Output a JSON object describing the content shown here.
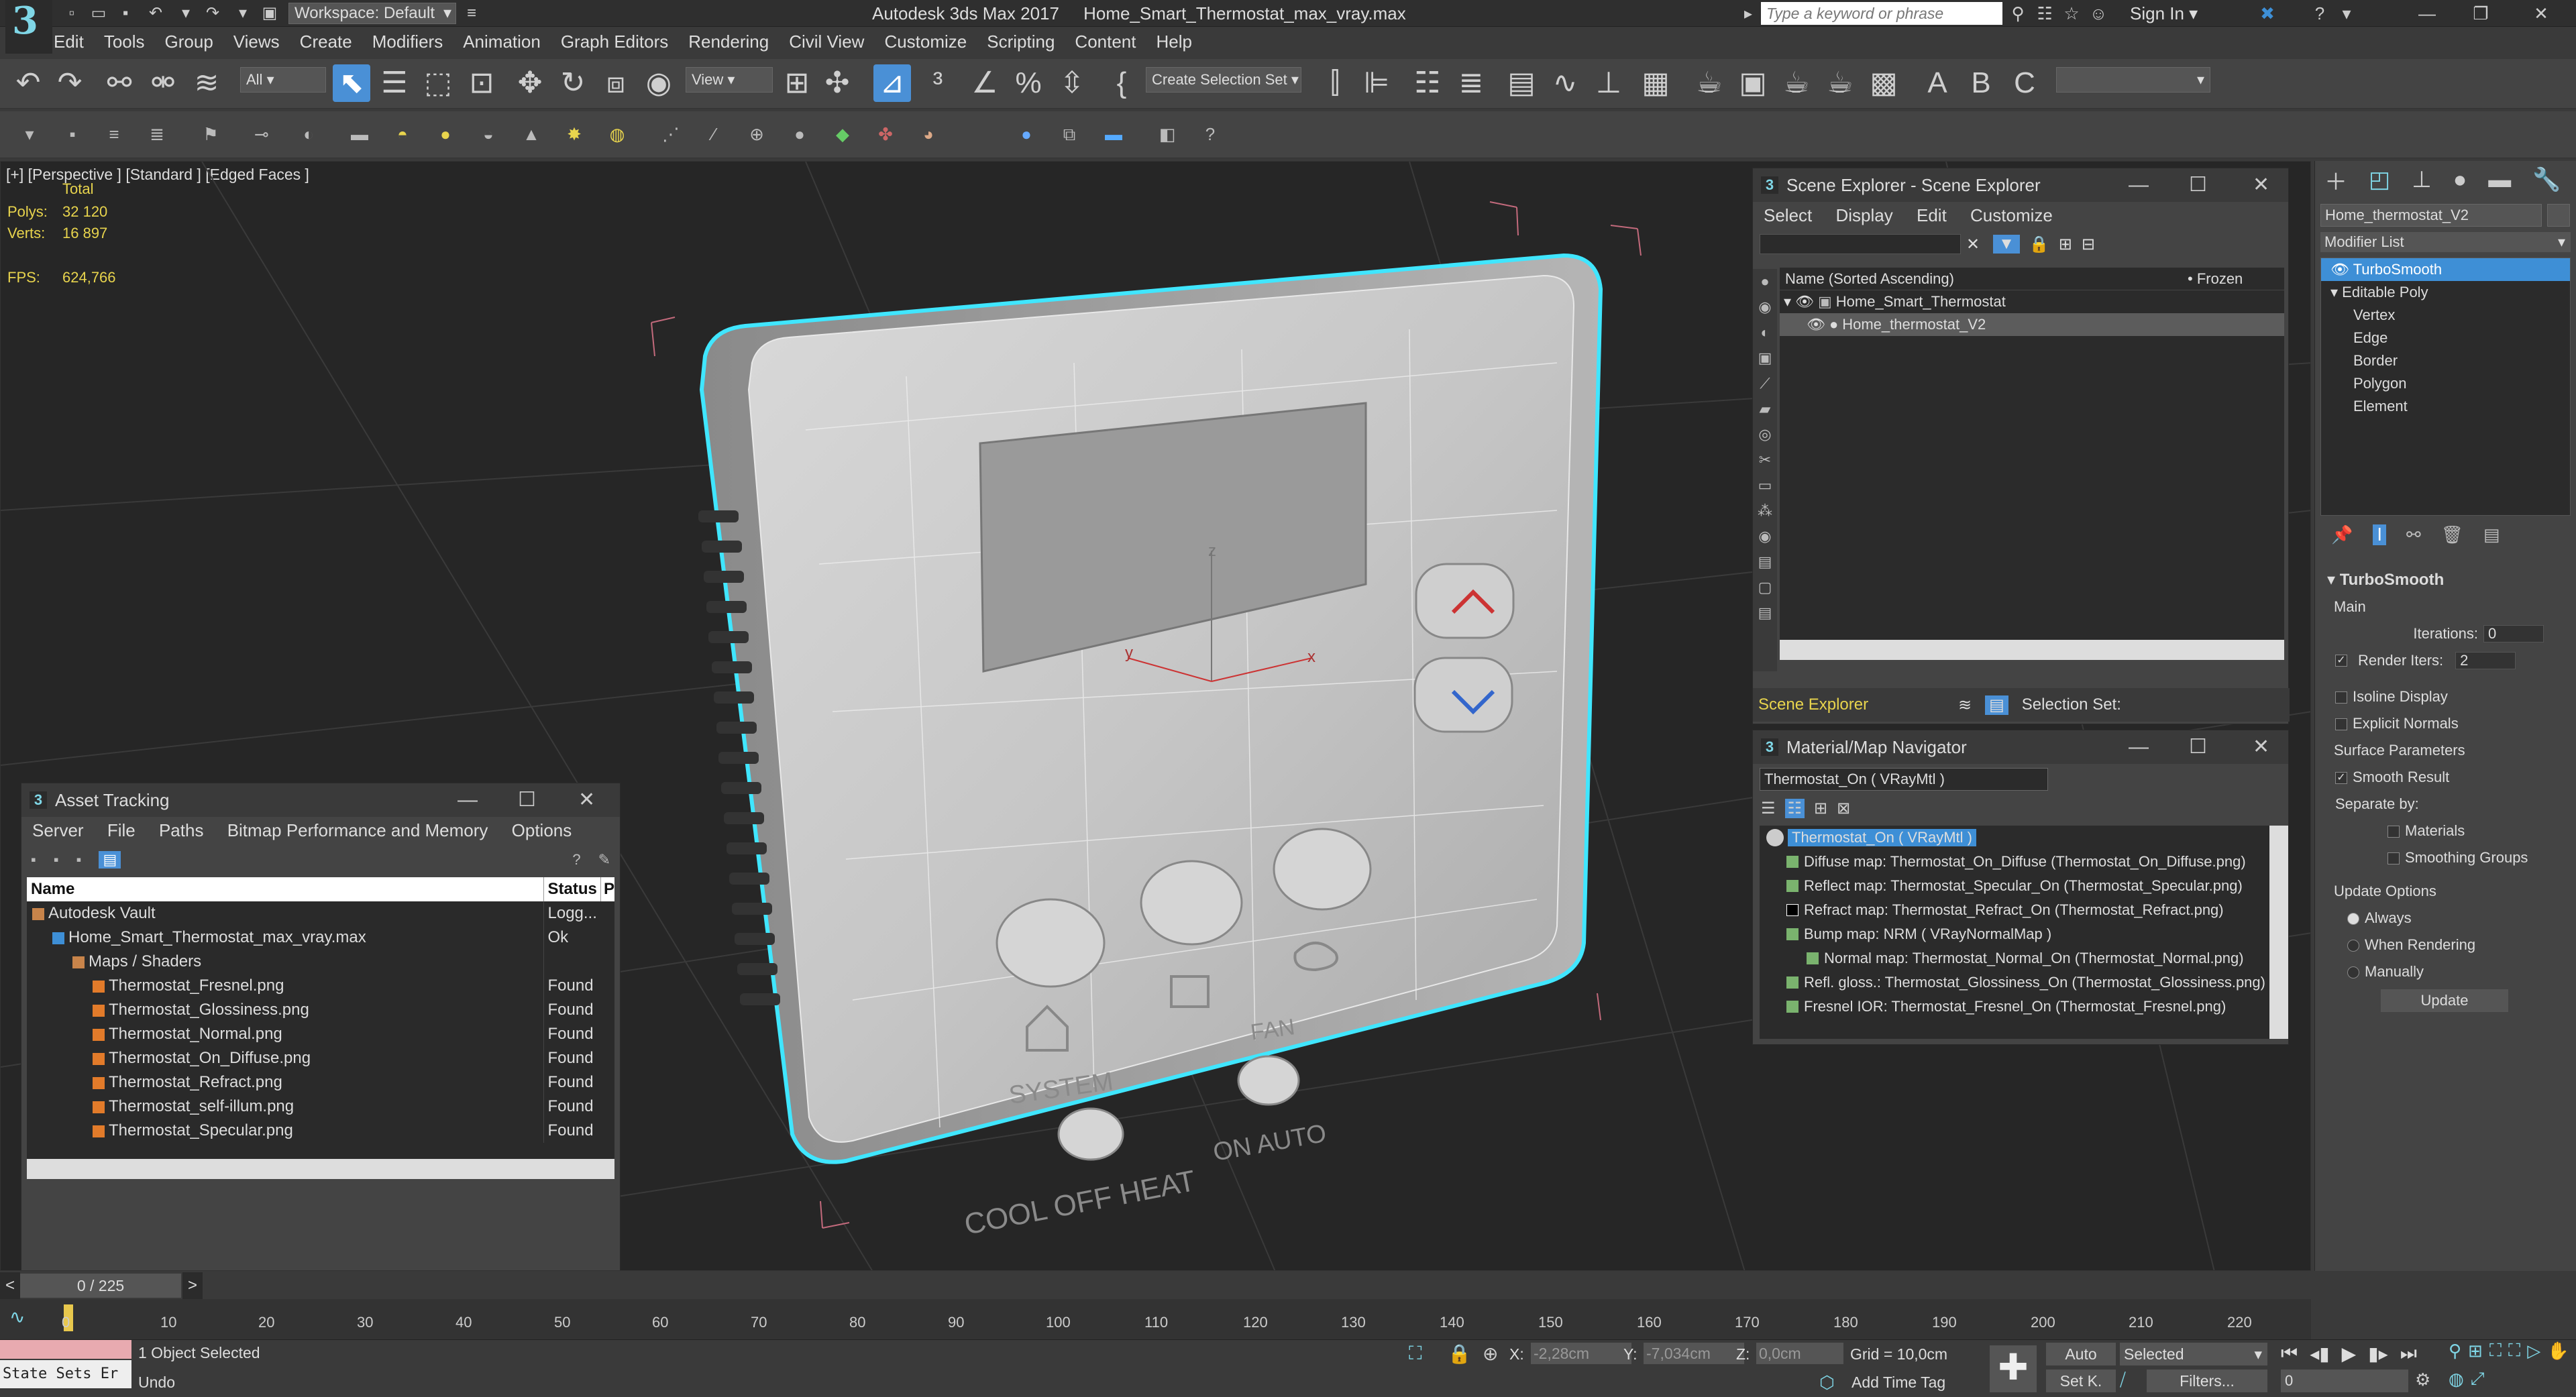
{
  "app": {
    "title": "Autodesk 3ds Max 2017",
    "file": "Home_Smart_Thermostat_max_vray.max",
    "workspace": "Workspace: Default",
    "search_placeholder": "Type a keyword or phrase",
    "sign_in": "Sign In"
  },
  "menu": [
    "Edit",
    "Tools",
    "Group",
    "Views",
    "Create",
    "Modifiers",
    "Animation",
    "Graph Editors",
    "Rendering",
    "Civil View",
    "Customize",
    "Scripting",
    "Content",
    "Help"
  ],
  "toolbar": {
    "filter": "All",
    "view": "View",
    "selection_set": "Create Selection Set"
  },
  "viewport": {
    "label": "[+] [Perspective ] [Standard ] [Edged Faces ]",
    "total": "Total",
    "polys_label": "Polys:",
    "polys": "32 120",
    "verts_label": "Verts:",
    "verts": "16 897",
    "fps_label": "FPS:",
    "fps": "624,766",
    "model_text": {
      "system": "SYSTEM",
      "fan": "FAN",
      "on_auto": "ON AUTO",
      "cool_off_heat": "COOL OFF HEAT"
    },
    "axes": {
      "x": "x",
      "y": "y",
      "z": "z"
    }
  },
  "scene_explorer": {
    "title": "Scene Explorer - Scene Explorer",
    "menu": [
      "Select",
      "Display",
      "Edit",
      "Customize"
    ],
    "col_name": "Name (Sorted Ascending)",
    "col_frozen": "• Frozen",
    "items": [
      {
        "name": "Home_Smart_Thermostat",
        "selected": false
      },
      {
        "name": "Home_thermostat_V2",
        "selected": true
      }
    ],
    "footer_label": "Scene Explorer",
    "selection_set": "Selection Set:"
  },
  "material_navigator": {
    "title": "Material/Map Navigator",
    "field": "Thermostat_On  ( VRayMtl )",
    "root": "Thermostat_On  ( VRayMtl )",
    "items": [
      "Diffuse map: Thermostat_On_Diffuse (Thermostat_On_Diffuse.png)",
      "Reflect map: Thermostat_Specular_On (Thermostat_Specular.png)",
      "Refract map: Thermostat_Refract_On (Thermostat_Refract.png)",
      "Bump map: NRM  ( VRayNormalMap )",
      "Normal map: Thermostat_Normal_On (Thermostat_Normal.png)",
      "Refl. gloss.: Thermostat_Glossiness_On (Thermostat_Glossiness.png)",
      "Fresnel IOR: Thermostat_Fresnel_On (Thermostat_Fresnel.png)"
    ]
  },
  "asset_tracking": {
    "title": "Asset Tracking",
    "menu": [
      "Server",
      "File",
      "Paths",
      "Bitmap Performance and Memory",
      "Options"
    ],
    "col_name": "Name",
    "col_status": "Status",
    "col_p": "P",
    "rows": [
      {
        "name": "Autodesk Vault",
        "status": "Logg...",
        "indent": 0
      },
      {
        "name": "Home_Smart_Thermostat_max_vray.max",
        "status": "Ok",
        "indent": 1
      },
      {
        "name": "Maps / Shaders",
        "status": "",
        "indent": 2
      },
      {
        "name": "Thermostat_Fresnel.png",
        "status": "Found",
        "indent": 3
      },
      {
        "name": "Thermostat_Glossiness.png",
        "status": "Found",
        "indent": 3
      },
      {
        "name": "Thermostat_Normal.png",
        "status": "Found",
        "indent": 3
      },
      {
        "name": "Thermostat_On_Diffuse.png",
        "status": "Found",
        "indent": 3
      },
      {
        "name": "Thermostat_Refract.png",
        "status": "Found",
        "indent": 3
      },
      {
        "name": "Thermostat_self-illum.png",
        "status": "Found",
        "indent": 3
      },
      {
        "name": "Thermostat_Specular.png",
        "status": "Found",
        "indent": 3
      }
    ]
  },
  "command_panel": {
    "object_name": "Home_thermostat_V2",
    "modifier_list": "Modifier List",
    "stack": [
      {
        "name": "TurboSmooth",
        "level": 0,
        "selected": true
      },
      {
        "name": "Editable Poly",
        "level": 0,
        "selected": false
      },
      {
        "name": "Vertex",
        "level": 1
      },
      {
        "name": "Edge",
        "level": 1
      },
      {
        "name": "Border",
        "level": 1
      },
      {
        "name": "Polygon",
        "level": 1
      },
      {
        "name": "Element",
        "level": 1
      }
    ],
    "turbosmooth": {
      "title": "TurboSmooth",
      "main": "Main",
      "iterations_label": "Iterations:",
      "iterations": "0",
      "render_iters_label": "Render Iters:",
      "render_iters": "2",
      "isoline": "Isoline Display",
      "explicit_normals": "Explicit Normals",
      "surface_params": "Surface Parameters",
      "smooth_result": "Smooth Result",
      "separate_by": "Separate by:",
      "materials": "Materials",
      "smoothing_groups": "Smoothing Groups",
      "update_options": "Update Options",
      "always": "Always",
      "when_rendering": "When Rendering",
      "manually": "Manually",
      "update": "Update"
    }
  },
  "timeline": {
    "frame": "0 / 225",
    "ticks": [
      "0",
      "10",
      "20",
      "30",
      "40",
      "50",
      "60",
      "70",
      "80",
      "90",
      "100",
      "110",
      "120",
      "130",
      "140",
      "150",
      "160",
      "170",
      "180",
      "190",
      "200",
      "210",
      "220"
    ]
  },
  "status": {
    "state_sets": "State Sets Er",
    "selected": "1 Object Selected",
    "undo": "Undo",
    "x_label": "X:",
    "x": "-2,28cm",
    "y_label": "Y:",
    "y": "-7,034cm",
    "z_label": "Z:",
    "z": "0,0cm",
    "grid": "Grid = 10,0cm",
    "add_time_tag": "Add Time Tag",
    "auto": "Auto",
    "set_k": "Set K.",
    "selected_dd": "Selected",
    "filters": "Filters...",
    "frame_field": "0"
  }
}
